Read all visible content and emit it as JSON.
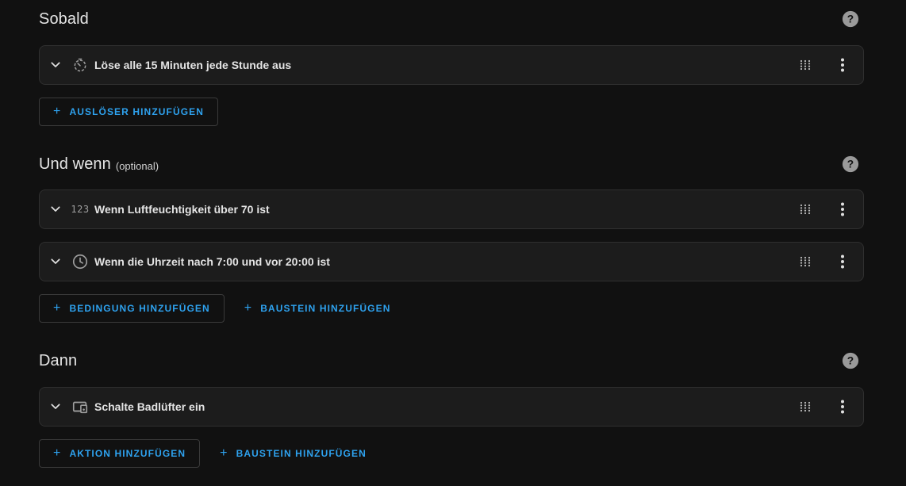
{
  "sections": {
    "trigger": {
      "title": "Sobald",
      "items": [
        {
          "label": "Löse alle 15 Minuten jede Stunde aus",
          "icon": "timer-outline-icon"
        }
      ],
      "buttons": [
        {
          "label": "AUSLÖSER HINZUFÜGEN"
        }
      ]
    },
    "condition": {
      "title": "Und wenn",
      "optional": "(optional)",
      "items": [
        {
          "label": "Wenn Luftfeuchtigkeit über 70 ist",
          "icon": "numeric-icon",
          "icon_text": "123"
        },
        {
          "label": "Wenn die Uhrzeit nach 7:00 und vor 20:00 ist",
          "icon": "clock-outline-icon"
        }
      ],
      "buttons": [
        {
          "label": "BEDINGUNG HINZUFÜGEN"
        },
        {
          "label": "BAUSTEIN HINZUFÜGEN"
        }
      ]
    },
    "action": {
      "title": "Dann",
      "items": [
        {
          "label": "Schalte Badlüfter ein",
          "icon": "devices-icon"
        }
      ],
      "buttons": [
        {
          "label": "AKTION HINZUFÜGEN"
        },
        {
          "label": "BAUSTEIN HINZUFÜGEN"
        }
      ]
    }
  },
  "colors": {
    "background": "#111111",
    "card": "#1c1c1c",
    "accent": "#2ea2ef",
    "text": "#e4e4e4"
  }
}
